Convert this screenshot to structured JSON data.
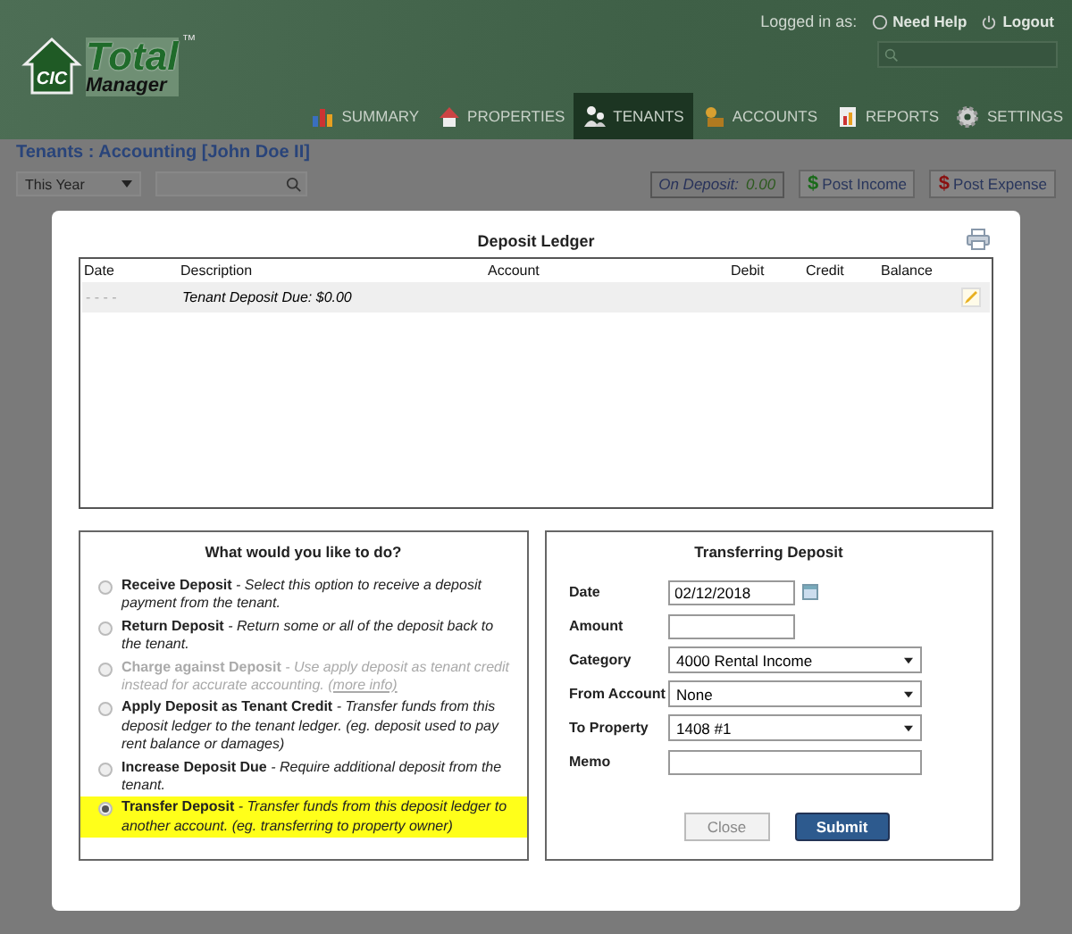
{
  "header": {
    "logo_mark": "CIC",
    "logo_title": "Total",
    "logo_subtitle": "Manager",
    "trademark": "™",
    "logged_in_label": "Logged in as:",
    "help": "Need Help",
    "logout": "Logout"
  },
  "nav": [
    {
      "label": "SUMMARY",
      "selected": false
    },
    {
      "label": "PROPERTIES",
      "selected": false
    },
    {
      "label": "TENANTS",
      "selected": true
    },
    {
      "label": "ACCOUNTS",
      "selected": false
    },
    {
      "label": "REPORTS",
      "selected": false
    },
    {
      "label": "SETTINGS",
      "selected": false
    }
  ],
  "breadcrumb": "Tenants : Accounting [John Doe II]",
  "toolbar": {
    "period": "This Year",
    "on_deposit_label": "On Deposit:",
    "on_deposit_value": "0.00",
    "post_income": "Post Income",
    "post_expense": "Post Expense",
    "currency_symbol": "$"
  },
  "modal": {
    "title": "Deposit Ledger",
    "ledger": {
      "columns": [
        "Date",
        "Description",
        "Account",
        "Debit",
        "Credit",
        "Balance"
      ],
      "rows": [
        {
          "date": "- - - -",
          "description": "Tenant Deposit Due: $0.00"
        }
      ]
    },
    "options_title": "What would you like to do?",
    "options": [
      {
        "title": "Receive Deposit",
        "description": "- Select this option to receive a deposit payment from the tenant.",
        "selected": false,
        "disabled": false
      },
      {
        "title": "Return Deposit",
        "description": "- Return some or all of the deposit back to the tenant.",
        "selected": false,
        "disabled": false
      },
      {
        "title": "Charge against Deposit",
        "description": "- Use apply deposit as tenant credit instead for accurate accounting.",
        "link": "(more info)",
        "selected": false,
        "disabled": true
      },
      {
        "title": "Apply Deposit as Tenant Credit",
        "description": "- Transfer funds from this deposit ledger to the tenant ledger. (eg. deposit used to pay rent balance or damages)",
        "selected": false,
        "disabled": false
      },
      {
        "title": "Increase Deposit Due",
        "description": "- Require additional deposit from the tenant.",
        "selected": false,
        "disabled": false
      },
      {
        "title": "Transfer Deposit",
        "description": "- Transfer funds from this deposit ledger to another account. (eg. transferring to property owner)",
        "selected": true,
        "disabled": false
      }
    ],
    "form_title": "Transferring Deposit",
    "fields": [
      {
        "label": "Date",
        "kind": "date",
        "value": "02/12/2018"
      },
      {
        "label": "Amount",
        "kind": "text"
      },
      {
        "label": "Category",
        "kind": "select",
        "value": "4000 Rental Income"
      },
      {
        "label": "From Account",
        "kind": "select",
        "value": "None"
      },
      {
        "label": "To Property",
        "kind": "select",
        "value": "1408 #1"
      },
      {
        "label": "Memo",
        "kind": "wide"
      }
    ],
    "close": "Close",
    "submit": "Submit"
  }
}
